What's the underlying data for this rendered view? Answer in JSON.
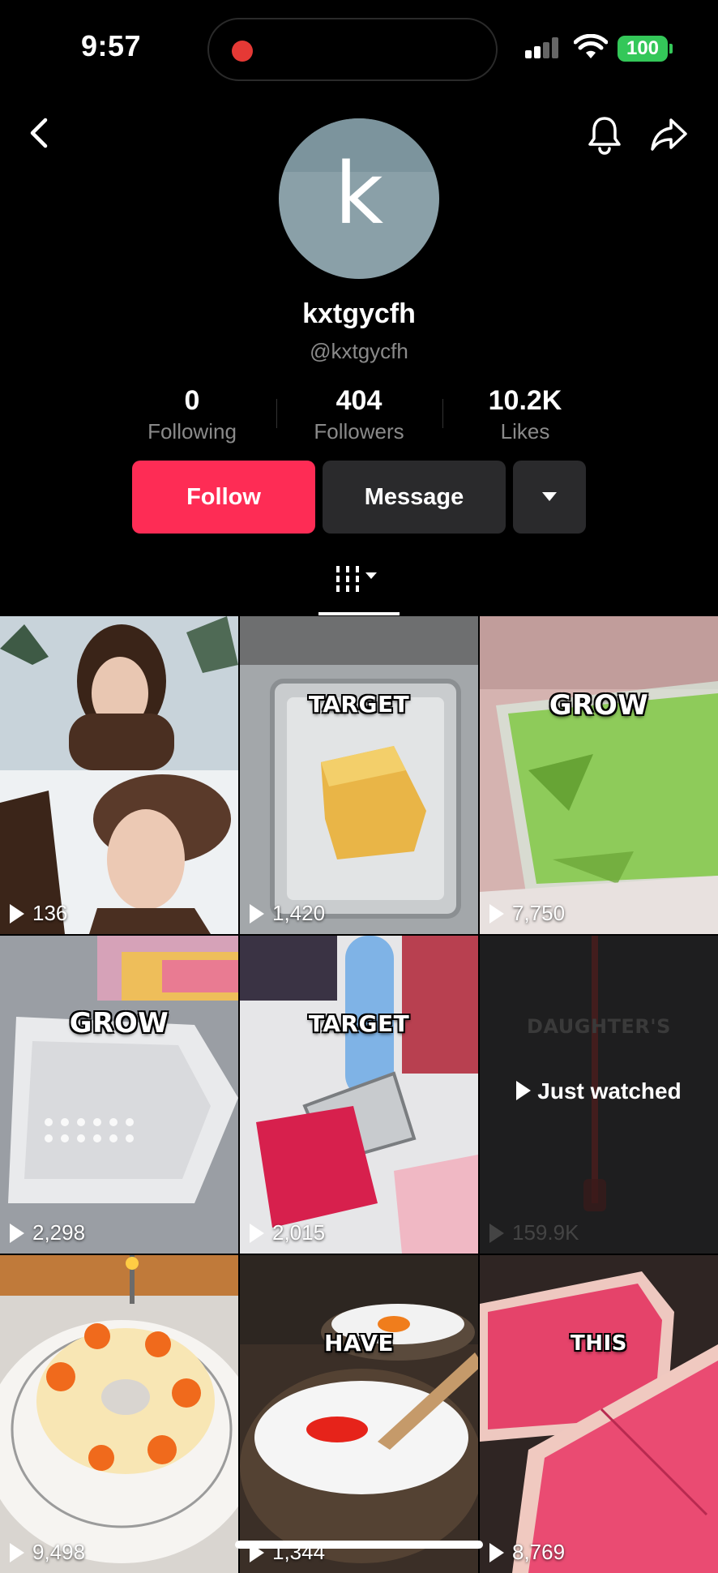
{
  "status_bar": {
    "time": "9:57",
    "battery": "100",
    "icons": [
      "recording-dot-icon",
      "signal-icon",
      "wifi-icon",
      "battery-icon"
    ]
  },
  "nav": {
    "icons": [
      "back-arrow-icon",
      "bell-icon",
      "share-icon"
    ]
  },
  "profile": {
    "avatar_letter": "k",
    "display_name": "kxtgycfh",
    "handle": "@kxtgycfh",
    "stats": [
      {
        "value": "0",
        "label": "Following"
      },
      {
        "value": "404",
        "label": "Followers"
      },
      {
        "value": "10.2K",
        "label": "Likes"
      }
    ]
  },
  "actions": {
    "follow_label": "Follow",
    "message_label": "Message"
  },
  "tabs": {
    "active": "videos-grid-icon"
  },
  "colors": {
    "follow": "#fe2c55",
    "secondary_button": "#2a2a2c",
    "battery": "#34c759",
    "recording": "#e53935"
  },
  "videos": [
    {
      "caption": "",
      "views": "136"
    },
    {
      "caption": "TARGET",
      "views": "1,420"
    },
    {
      "caption": "GROW",
      "views": "7,750"
    },
    {
      "caption": "GROW",
      "views": "2,298"
    },
    {
      "caption": "TARGET",
      "views": "2,015"
    },
    {
      "caption": "DAUGHTER'S",
      "views": "159.9K",
      "overlay": "Just watched"
    },
    {
      "caption": "",
      "views": "9,498"
    },
    {
      "caption": "HAVE",
      "views": "1,344"
    },
    {
      "caption": "THIS",
      "views": "8,769"
    }
  ]
}
